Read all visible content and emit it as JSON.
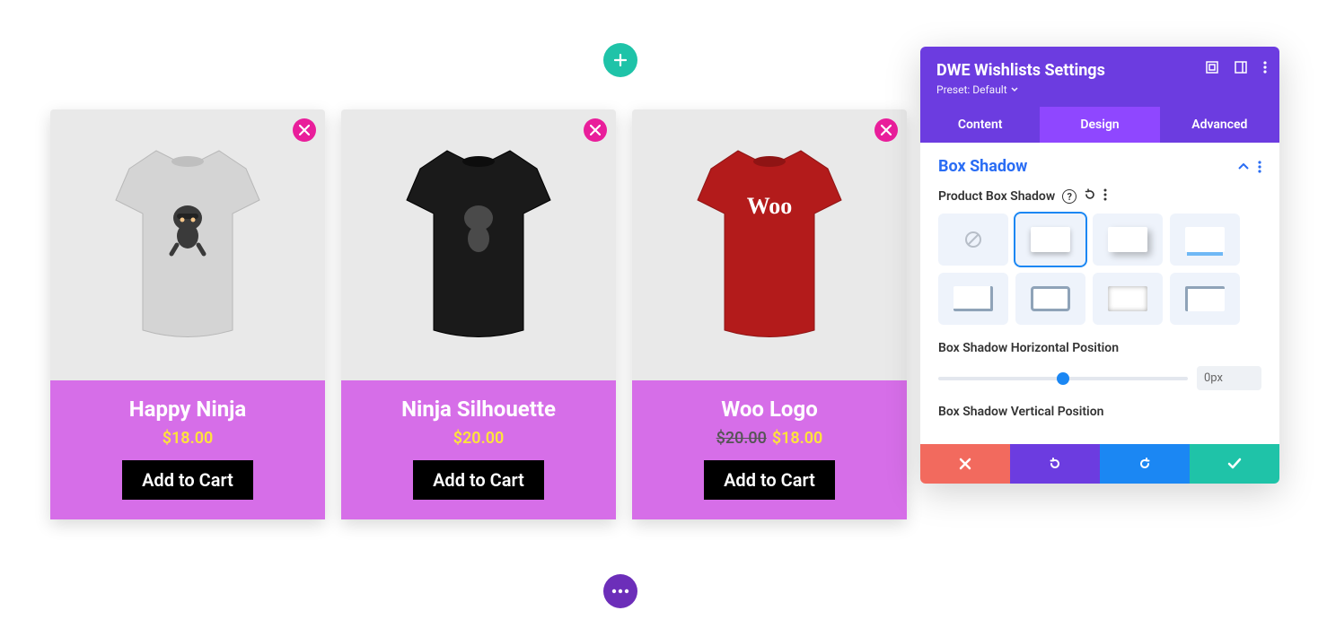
{
  "products": [
    {
      "title": "Happy Ninja",
      "price": "$18.00",
      "old_price": "",
      "btn": "Add to Cart"
    },
    {
      "title": "Ninja Silhouette",
      "price": "$20.00",
      "old_price": "",
      "btn": "Add to Cart"
    },
    {
      "title": "Woo Logo",
      "price": "$18.00",
      "old_price": "$20.00",
      "btn": "Add to Cart"
    }
  ],
  "panel": {
    "title": "DWE Wishlists Settings",
    "preset": "Preset: Default",
    "tabs": {
      "content": "Content",
      "design": "Design",
      "advanced": "Advanced",
      "active": "design"
    },
    "section": "Box Shadow",
    "option_label": "Product Box Shadow",
    "horiz_label": "Box Shadow Horizontal Position",
    "horiz_value": "0px",
    "vert_label": "Box Shadow Vertical Position"
  }
}
